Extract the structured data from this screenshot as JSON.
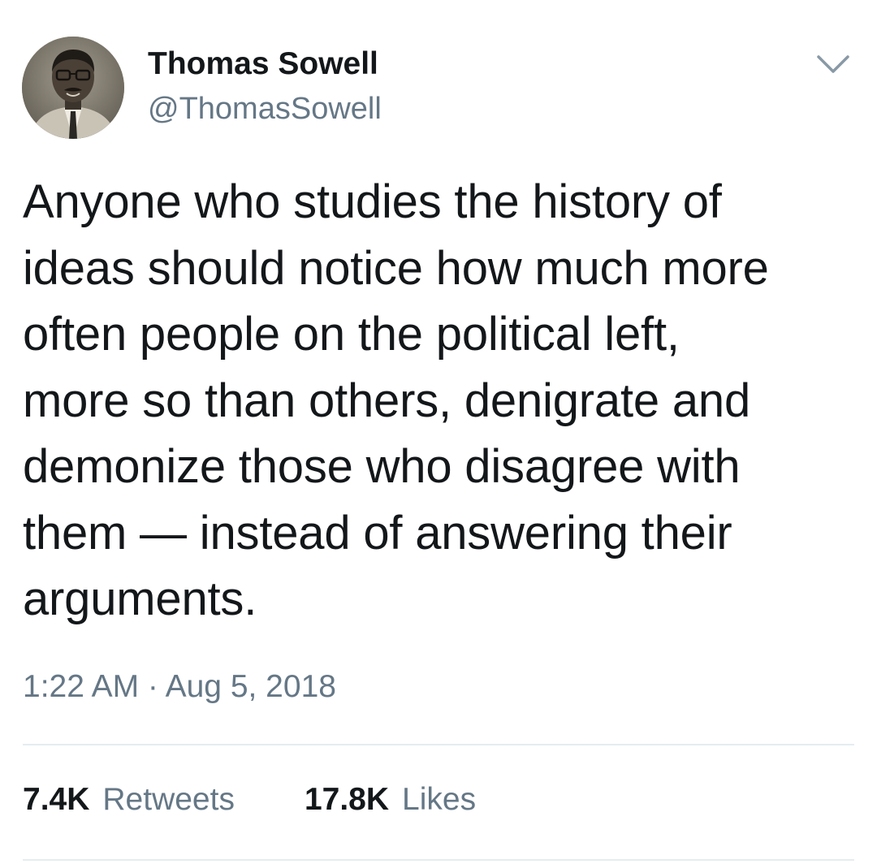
{
  "tweet": {
    "author": {
      "display_name": "Thomas Sowell",
      "handle": "@ThomasSowell",
      "avatar_icon": "profile-photo"
    },
    "menu_icon": "chevron-down-icon",
    "text": "Anyone who studies the history of\nideas should notice how much more\noften people on the political left,\nmore so than others, denigrate and\ndemonize those who disagree with\nthem — instead of answering their\narguments.",
    "timestamp": "1:22 AM · Aug 5, 2018",
    "stats": {
      "retweets_count": "7.4K",
      "retweets_label": "Retweets",
      "likes_count": "17.8K",
      "likes_label": "Likes"
    },
    "colors": {
      "primary_text": "#14171a",
      "secondary_text": "#657786",
      "divider": "#e6ecf0"
    }
  }
}
